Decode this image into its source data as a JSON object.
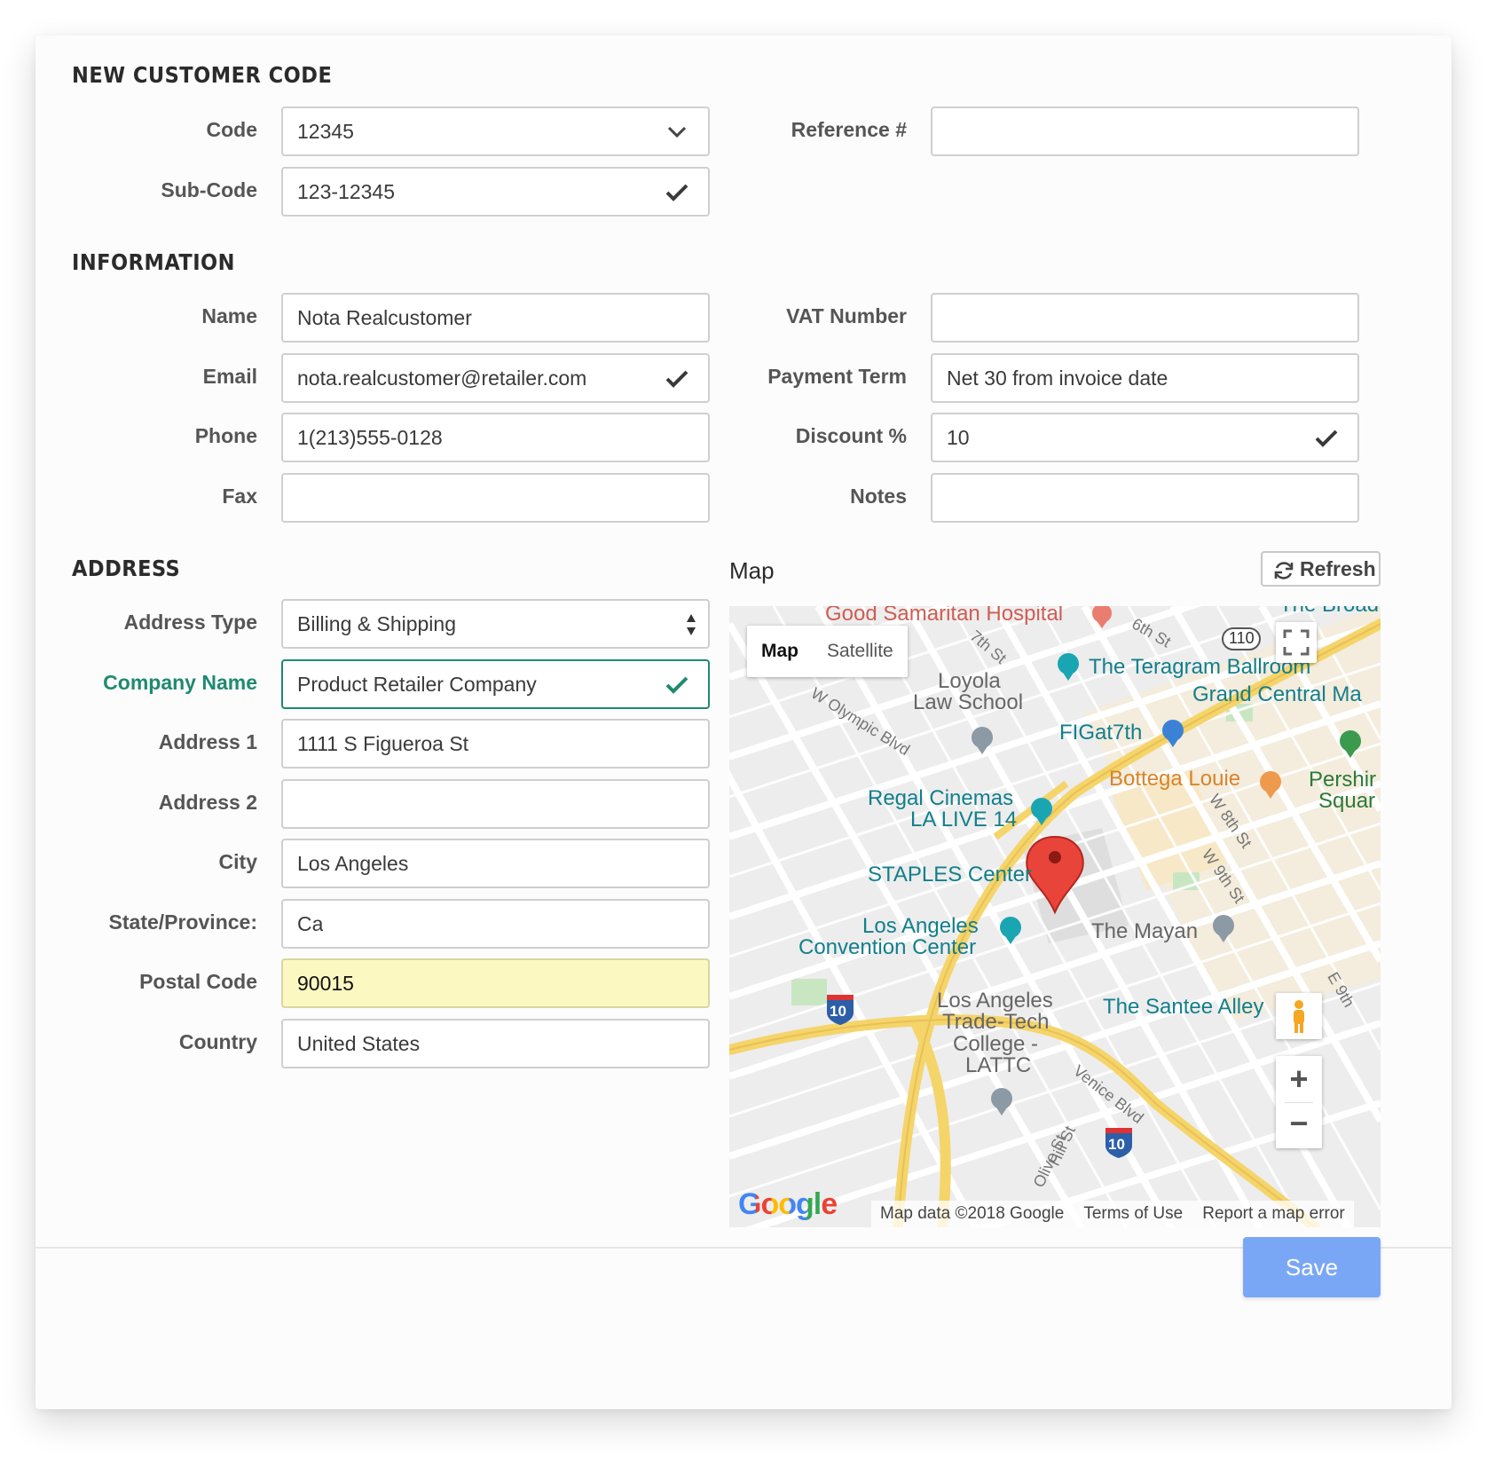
{
  "sections": {
    "new_customer_code": "NEW CUSTOMER CODE",
    "information": "INFORMATION",
    "address": "ADDRESS"
  },
  "code": {
    "code_label": "Code",
    "code_value": "12345",
    "subcode_label": "Sub-Code",
    "subcode_value": "123-12345",
    "reference_label": "Reference #",
    "reference_value": ""
  },
  "info": {
    "name_label": "Name",
    "name_value": "Nota Realcustomer",
    "email_label": "Email",
    "email_value": "nota.realcustomer@retailer.com",
    "phone_label": "Phone",
    "phone_value": "1(213)555-0128",
    "fax_label": "Fax",
    "fax_value": "",
    "vat_label": "VAT Number",
    "vat_value": "",
    "payment_label": "Payment Term",
    "payment_value": "Net 30 from invoice date",
    "discount_label": "Discount %",
    "discount_value": "10",
    "notes_label": "Notes",
    "notes_value": ""
  },
  "address": {
    "type_label": "Address Type",
    "type_value": "Billing & Shipping",
    "company_label": "Company Name",
    "company_value": "Product Retailer Company",
    "address1_label": "Address 1",
    "address1_value": "1111 S Figueroa St",
    "address2_label": "Address 2",
    "address2_value": "",
    "city_label": "City",
    "city_value": "Los Angeles",
    "state_label": "State/Province:",
    "state_value": "Ca",
    "postal_label": "Postal Code",
    "postal_value": "90015",
    "country_label": "Country",
    "country_value": "United States"
  },
  "map": {
    "title": "Map",
    "refresh_label": "Refresh",
    "type_map": "Map",
    "type_satellite": "Satellite",
    "pois": {
      "good_samaritan": "Good Samaritan Hospital",
      "the_broad": "The Broad",
      "teragram": "The Teragram Ballroom",
      "grand_central": "Grand Central Ma",
      "loyola_1": "Loyola",
      "loyola_2": "Law School",
      "figat7th": "FIGat7th",
      "bottega": "Bottega Louie",
      "pershing_1": "Pershir",
      "pershing_2": "Squar",
      "regal_1": "Regal Cinemas",
      "regal_2": "LA LIVE 14",
      "staples": "STAPLES Center",
      "convention_1": "Los Angeles",
      "convention_2": "Convention Center",
      "mayan": "The Mayan",
      "tradetech_1": "Los Angeles",
      "tradetech_2": "Trade-Tech",
      "tradetech_3": "College -",
      "tradetech_4": "LATTC",
      "santee": "The Santee Alley"
    },
    "streets": {
      "sixth": "6th St",
      "seventh": "7th St",
      "olympic": "W Olympic Blvd",
      "eighth": "W 8th St",
      "ninth": "W 9th St",
      "e_ninth": "E 9th",
      "venice": "Venice Blvd",
      "olive": "Olive St",
      "hill": "Hill St"
    },
    "shields": {
      "h110": "110",
      "i10": "10"
    },
    "logo": "Google",
    "data_credit": "Map data ©2018 Google",
    "terms": "Terms of Use",
    "report": "Report a map error",
    "zoom_in": "+",
    "zoom_out": "−"
  },
  "actions": {
    "save_label": "Save"
  },
  "colors": {
    "success": "#1f8a6f",
    "save": "#7aa7f5",
    "warning_bg": "#fbf8c2"
  }
}
